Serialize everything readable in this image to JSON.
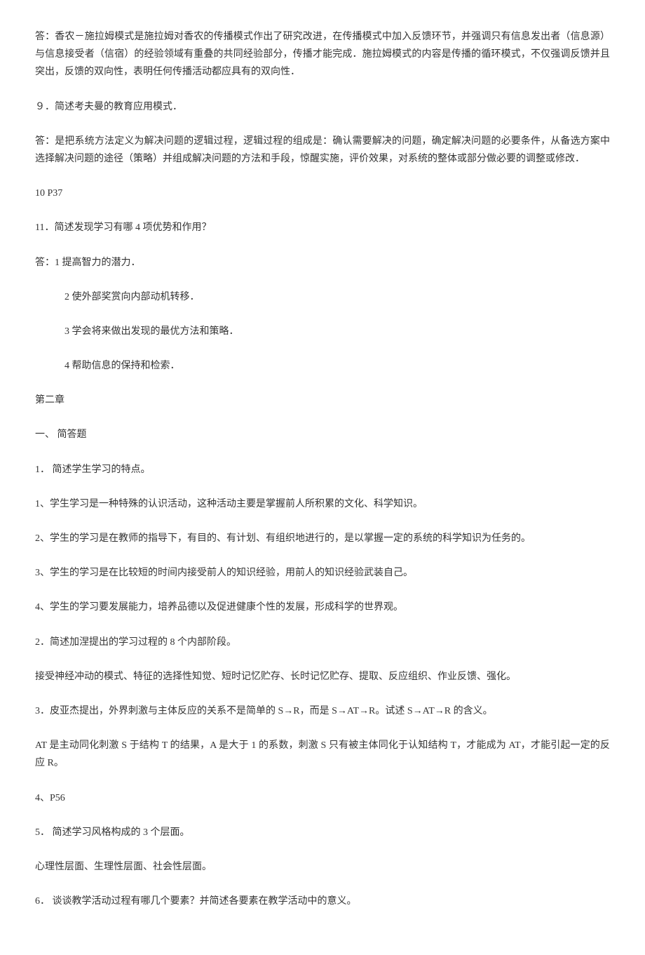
{
  "paragraphs": {
    "p1": "答：香农－施拉姆模式是施拉姆对香农的传播模式作出了研究改进，在传播模式中加入反馈环节，并强调只有信息发出者（信息源）与信息接受者（信宿）的经验领域有重叠的共同经验部分，传播才能完成．施拉姆模式的内容是传播的循环模式，不仅强调反馈并且突出，反馈的双向性，表明任何传播活动都应具有的双向性．",
    "p2": "９．简述考夫曼的教育应用模式．",
    "p3": "答：是把系统方法定义为解决问题的逻辑过程，逻辑过程的组成是：确认需要解决的问题，确定解决问题的必要条件，从备选方案中选择解决问题的途径（策略）并组成解决问题的方法和手段，惊醒实施，评价效果，对系统的整体或部分做必要的调整或修改．",
    "p4": "10 P37",
    "p5": "11．简述发现学习有哪 4 项优势和作用？",
    "p6": "答：1 提高智力的潜力．",
    "p7": "2 使外部奖赏向内部动机转移．",
    "p8": "3 学会将来做出发现的最优方法和策略．",
    "p9": "4 帮助信息的保持和检索．",
    "p10": "第二章",
    "p11": "一、 简答题",
    "p12": "1． 简述学生学习的特点。",
    "p13": "1、学生学习是一种特殊的认识活动，这种活动主要是掌握前人所积累的文化、科学知识。",
    "p14": "2、学生的学习是在教师的指导下，有目的、有计划、有组织地进行的，是以掌握一定的系统的科学知识为任务的。",
    "p15": "3、学生的学习是在比较短的时间内接受前人的知识经验，用前人的知识经验武装自己。",
    "p16": "4、学生的学习要发展能力，培养品德以及促进健康个性的发展，形成科学的世界观。",
    "p17": "2．简述加涅提出的学习过程的 8 个内部阶段。",
    "p18": "接受神经冲动的模式、特征的选择性知觉、短时记忆贮存、长时记忆贮存、提取、反应组织、作业反馈、强化。",
    "p19": "3．皮亚杰提出，外界刺激与主体反应的关系不是简单的 S→R，而是 S→AT→R。试述 S→AT→R 的含义。",
    "p20": "AT 是主动同化刺激 S 于结构 T 的结果，A 是大于 1 的系数，刺激 S 只有被主体同化于认知结构 T，才能成为 AT，才能引起一定的反应 R。",
    "p21": "4、P56",
    "p22": "5． 简述学习风格构成的 3 个层面。",
    "p23": "心理性层面、生理性层面、社会性层面。",
    "p24": "6． 谈谈教学活动过程有哪几个要素？并简述各要素在教学活动中的意义。"
  }
}
